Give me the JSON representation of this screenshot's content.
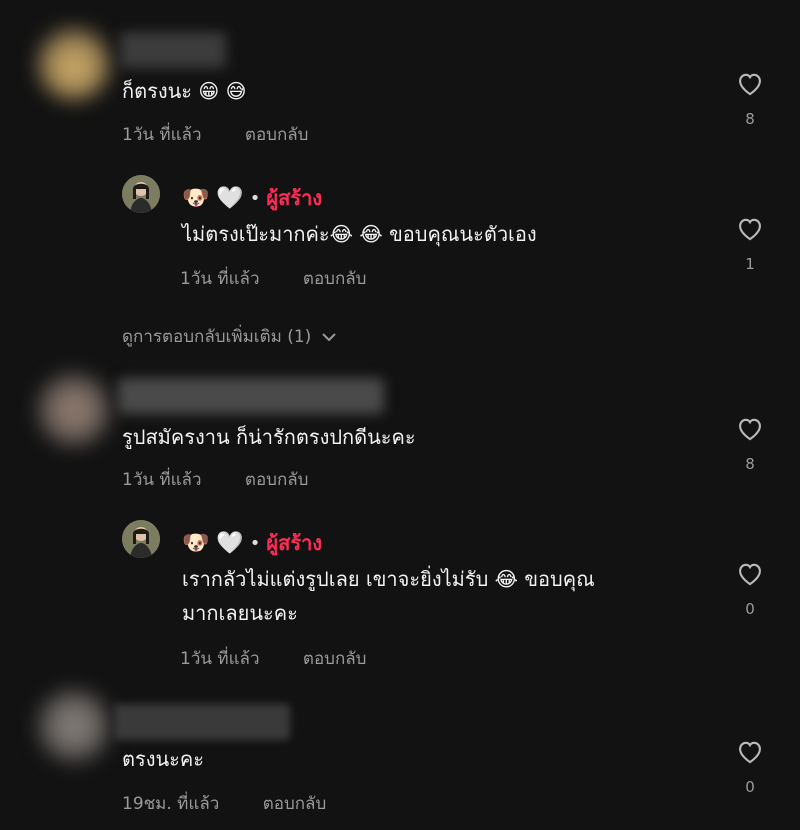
{
  "comments": [
    {
      "text": "ก็ตรงนะ 😁 😅",
      "time": "1วัน ที่แล้ว",
      "reply": "ตอบกลับ",
      "likes": "8",
      "avatar_color": "#a78d55",
      "reply_item": {
        "badge_emoji": "🐶 🤍",
        "creator": "ผู้สร้าง",
        "text": "ไม่ตรงเป๊ะมากค่ะ😂 😂  ขอบคุณนะตัวเอง",
        "time": "1วัน ที่แล้ว",
        "reply": "ตอบกลับ",
        "likes": "1"
      },
      "view_more": "ดูการตอบกลับเพิ่มเติม (1)"
    },
    {
      "text": "รูปสมัครงาน ก็น่ารักตรงปกดีนะคะ",
      "time": "1วัน ที่แล้ว",
      "reply": "ตอบกลับ",
      "likes": "8",
      "avatar_color": "#7a6a62",
      "reply_item": {
        "badge_emoji": "🐶 🤍",
        "creator": "ผู้สร้าง",
        "text_line1": "เรากลัวไม่แต่งรูปเลย เขาจะยิ่งไม่รับ 😂  ขอบคุณ",
        "text_line2": "มากเลยนะคะ",
        "time": "1วัน ที่แล้ว",
        "reply": "ตอบกลับ",
        "likes": "0"
      }
    },
    {
      "text": "ตรงนะคะ",
      "time": "19ชม. ที่แล้ว",
      "reply": "ตอบกลับ",
      "likes": "0",
      "avatar_color": "#6f6a66"
    }
  ],
  "icons": {
    "like": "heart-outline-icon",
    "expand": "chevron-down-icon"
  }
}
